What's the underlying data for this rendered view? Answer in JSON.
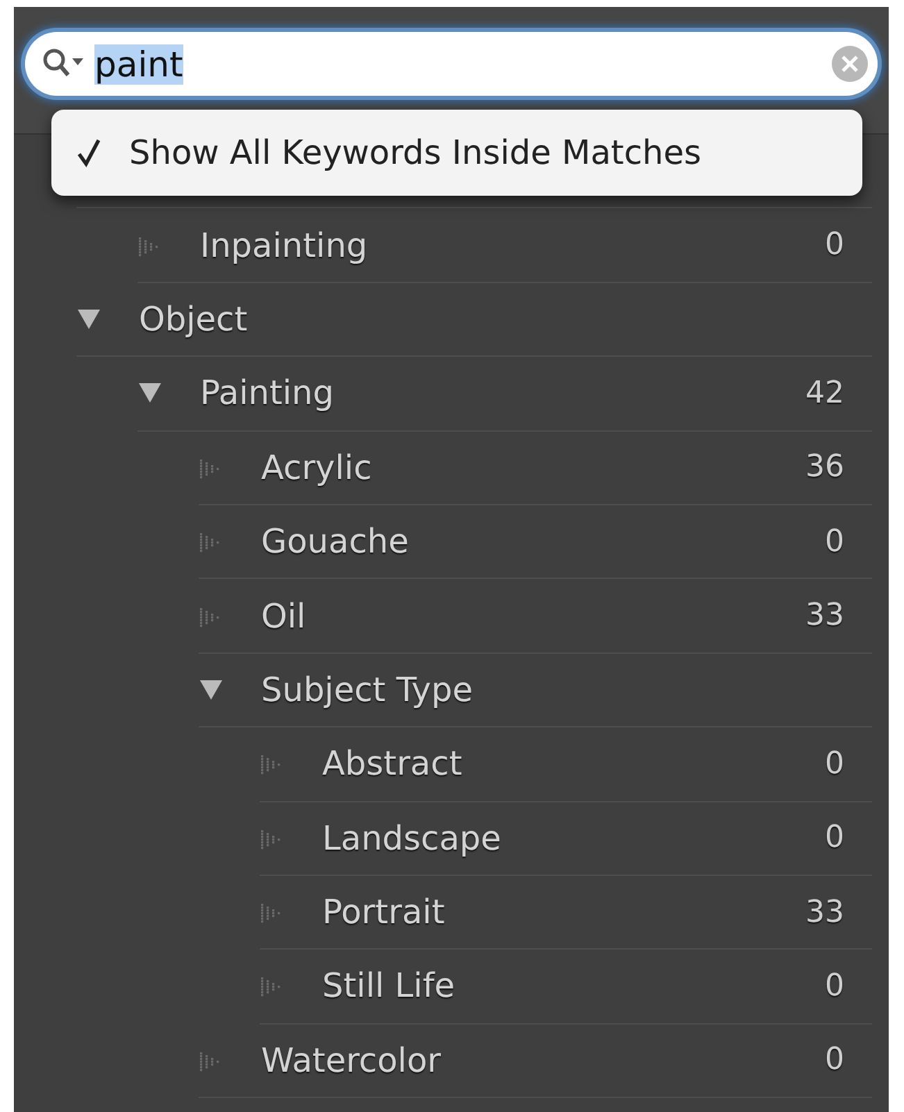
{
  "search": {
    "value": "paint",
    "selected_text": true
  },
  "menu": {
    "items": [
      {
        "label": "Show All Keywords Inside Matches",
        "checked": true
      }
    ]
  },
  "tree": [
    {
      "children": [
        {
          "label": "Inpainting",
          "count": "0"
        }
      ]
    },
    {
      "label": "Object",
      "expanded": true,
      "children": [
        {
          "label": "Painting",
          "count": "42",
          "expanded": true,
          "children": [
            {
              "label": "Acrylic",
              "count": "36"
            },
            {
              "label": "Gouache",
              "count": "0"
            },
            {
              "label": "Oil",
              "count": "33"
            },
            {
              "label": "Subject Type",
              "expanded": true,
              "children": [
                {
                  "label": "Abstract",
                  "count": "0"
                },
                {
                  "label": "Landscape",
                  "count": "0"
                },
                {
                  "label": "Portrait",
                  "count": "33"
                },
                {
                  "label": "Still Life",
                  "count": "0"
                }
              ]
            },
            {
              "label": "Watercolor",
              "count": "0"
            }
          ]
        }
      ]
    }
  ]
}
